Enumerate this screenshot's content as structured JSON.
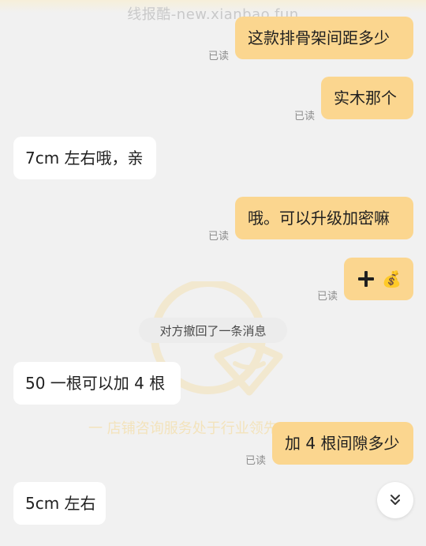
{
  "watermark": {
    "top_text": "线报酷-new.xianbao.fun",
    "slogan": "一 店铺咨询服务处于行业领先"
  },
  "status": {
    "read_label": "已读"
  },
  "system": {
    "recall_notice": "对方撤回了一条消息"
  },
  "messages": [
    {
      "side": "out",
      "text": "这款排骨架间距多少",
      "read": "已读"
    },
    {
      "side": "out",
      "text": "实木那个",
      "read": "已读"
    },
    {
      "side": "in",
      "text": "7cm 左右哦，亲"
    },
    {
      "side": "out",
      "text": "哦。可以升级加密嘛",
      "read": "已读"
    },
    {
      "side": "out",
      "emoji": "💰",
      "read": "已读",
      "icons": [
        "plus-icon",
        "money-bag-icon"
      ]
    },
    {
      "side": "in",
      "text": "50 一根可以加 4 根"
    },
    {
      "side": "out",
      "text": "加 4 根间隙多少",
      "read": "已读"
    },
    {
      "side": "in",
      "text": "5cm 左右"
    }
  ],
  "controls": {
    "scroll_down_icon": "double-chevron-down-icon"
  },
  "colors": {
    "outgoing_bubble": "#fbd68f",
    "incoming_bubble": "#ffffff",
    "background": "#f1f1f1"
  }
}
